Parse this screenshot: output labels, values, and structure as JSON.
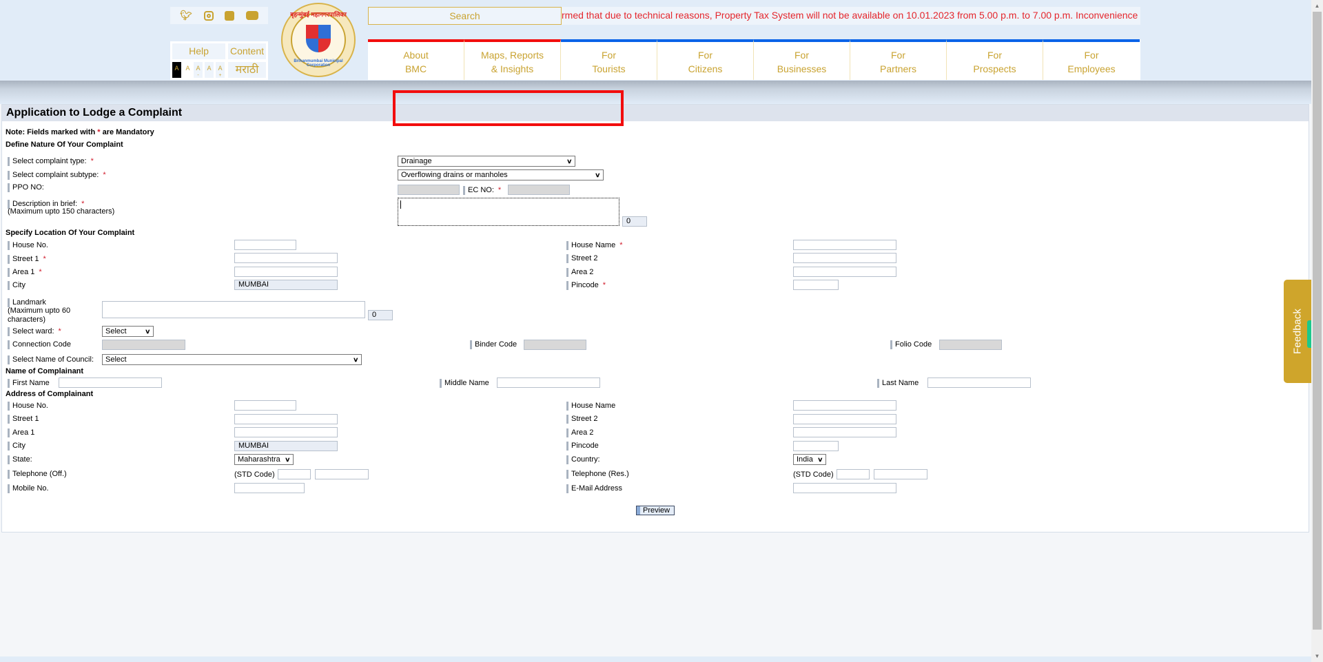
{
  "header": {
    "social_icons": [
      "twitter-icon",
      "instagram-icon",
      "facebook-icon",
      "youtube-icon"
    ],
    "help_label": "Help",
    "content_label": "Content",
    "language_label": "मराठी",
    "font_size_buttons": [
      "A",
      "A",
      "A",
      "A",
      "A"
    ],
    "font_size_sub": [
      "",
      "",
      "-",
      "",
      "+"
    ],
    "logo_text_top": "बृहन्मुंबई महानगरपालिका",
    "logo_text_bottom": "Brihanmumbai Municipal Corporation",
    "search_placeholder": "Search",
    "ticker_text": "rmed that due to technical reasons, Property Tax System will not be available on 10.01.2023 from 5.00 p.m. to 7.00 p.m. Inconvenience",
    "nav": [
      {
        "line1": "About",
        "line2": "BMC",
        "accent": "#f20d0d"
      },
      {
        "line1": "Maps, Reports",
        "line2": "& Insights",
        "accent": "#f20d0d"
      },
      {
        "line1": "For",
        "line2": "Tourists",
        "accent": "#0a63e8"
      },
      {
        "line1": "For",
        "line2": "Citizens",
        "accent": "#0a63e8"
      },
      {
        "line1": "For",
        "line2": "Businesses",
        "accent": "#0a63e8"
      },
      {
        "line1": "For",
        "line2": "Partners",
        "accent": "#0a63e8"
      },
      {
        "line1": "For",
        "line2": "Prospects",
        "accent": "#0a63e8"
      },
      {
        "line1": "For",
        "line2": "Employees",
        "accent": "#0a63e8"
      }
    ]
  },
  "form": {
    "title": "Application to Lodge a Complaint",
    "note_prefix": "Note: Fields marked with ",
    "note_star": "*",
    "note_suffix": " are Mandatory",
    "required_mark": "*",
    "nature": {
      "heading": "Define Nature Of Your Complaint",
      "complaint_type_label": "Select complaint type:",
      "complaint_type_value": "Drainage",
      "complaint_subtype_label": "Select complaint subtype:",
      "complaint_subtype_value": "Overflowing drains or manholes",
      "ppo_label": "PPO NO:",
      "ppo_value": "",
      "ec_label": "EC NO:",
      "ec_value": "",
      "description_label": "Description in brief:",
      "description_hint": "(Maximum upto 150 characters)",
      "description_value": "",
      "description_count": "0"
    },
    "location": {
      "heading": "Specify Location Of Your Complaint",
      "house_no_label": "House No.",
      "house_name_label": "House Name",
      "street1_label": "Street 1",
      "street2_label": "Street 2",
      "area1_label": "Area 1",
      "area2_label": "Area 2",
      "city_label": "City",
      "city_value": "MUMBAI",
      "pincode_label": "Pincode",
      "landmark_label": "Landmark",
      "landmark_hint": "(Maximum upto 60 characters)",
      "landmark_count": "0",
      "ward_label": "Select ward:",
      "ward_value": "Select",
      "connection_code_label": "Connection Code",
      "binder_code_label": "Binder Code",
      "folio_code_label": "Folio Code",
      "council_label": "Select Name of Council:",
      "council_value": "Select"
    },
    "name": {
      "heading": "Name of Complainant",
      "first_label": "First Name",
      "middle_label": "Middle Name",
      "last_label": "Last Name"
    },
    "address": {
      "heading": "Address of Complainant",
      "house_no_label": "House No.",
      "house_name_label": "House Name",
      "street1_label": "Street 1",
      "street2_label": "Street 2",
      "area1_label": "Area 1",
      "area2_label": "Area 2",
      "city_label": "City",
      "city_value": "MUMBAI",
      "pincode_label": "Pincode",
      "state_label": "State:",
      "state_value": "Maharashtra",
      "country_label": "Country:",
      "country_value": "India",
      "tel_off_label": "Telephone (Off.)",
      "tel_res_label": "Telephone (Res.)",
      "std_code_label": "(STD Code)",
      "mobile_label": "Mobile No.",
      "email_label": "E-Mail Address"
    },
    "preview_label": "Preview"
  },
  "feedback_label": "Feedback",
  "colors": {
    "brand_gold": "#c9a331",
    "ticker_red": "#e4262c",
    "highlight_red": "#f20d0d",
    "nav_blue": "#0a63e8",
    "feedback_gold": "#cfa52b",
    "feedback_accent": "#1cc98b"
  }
}
